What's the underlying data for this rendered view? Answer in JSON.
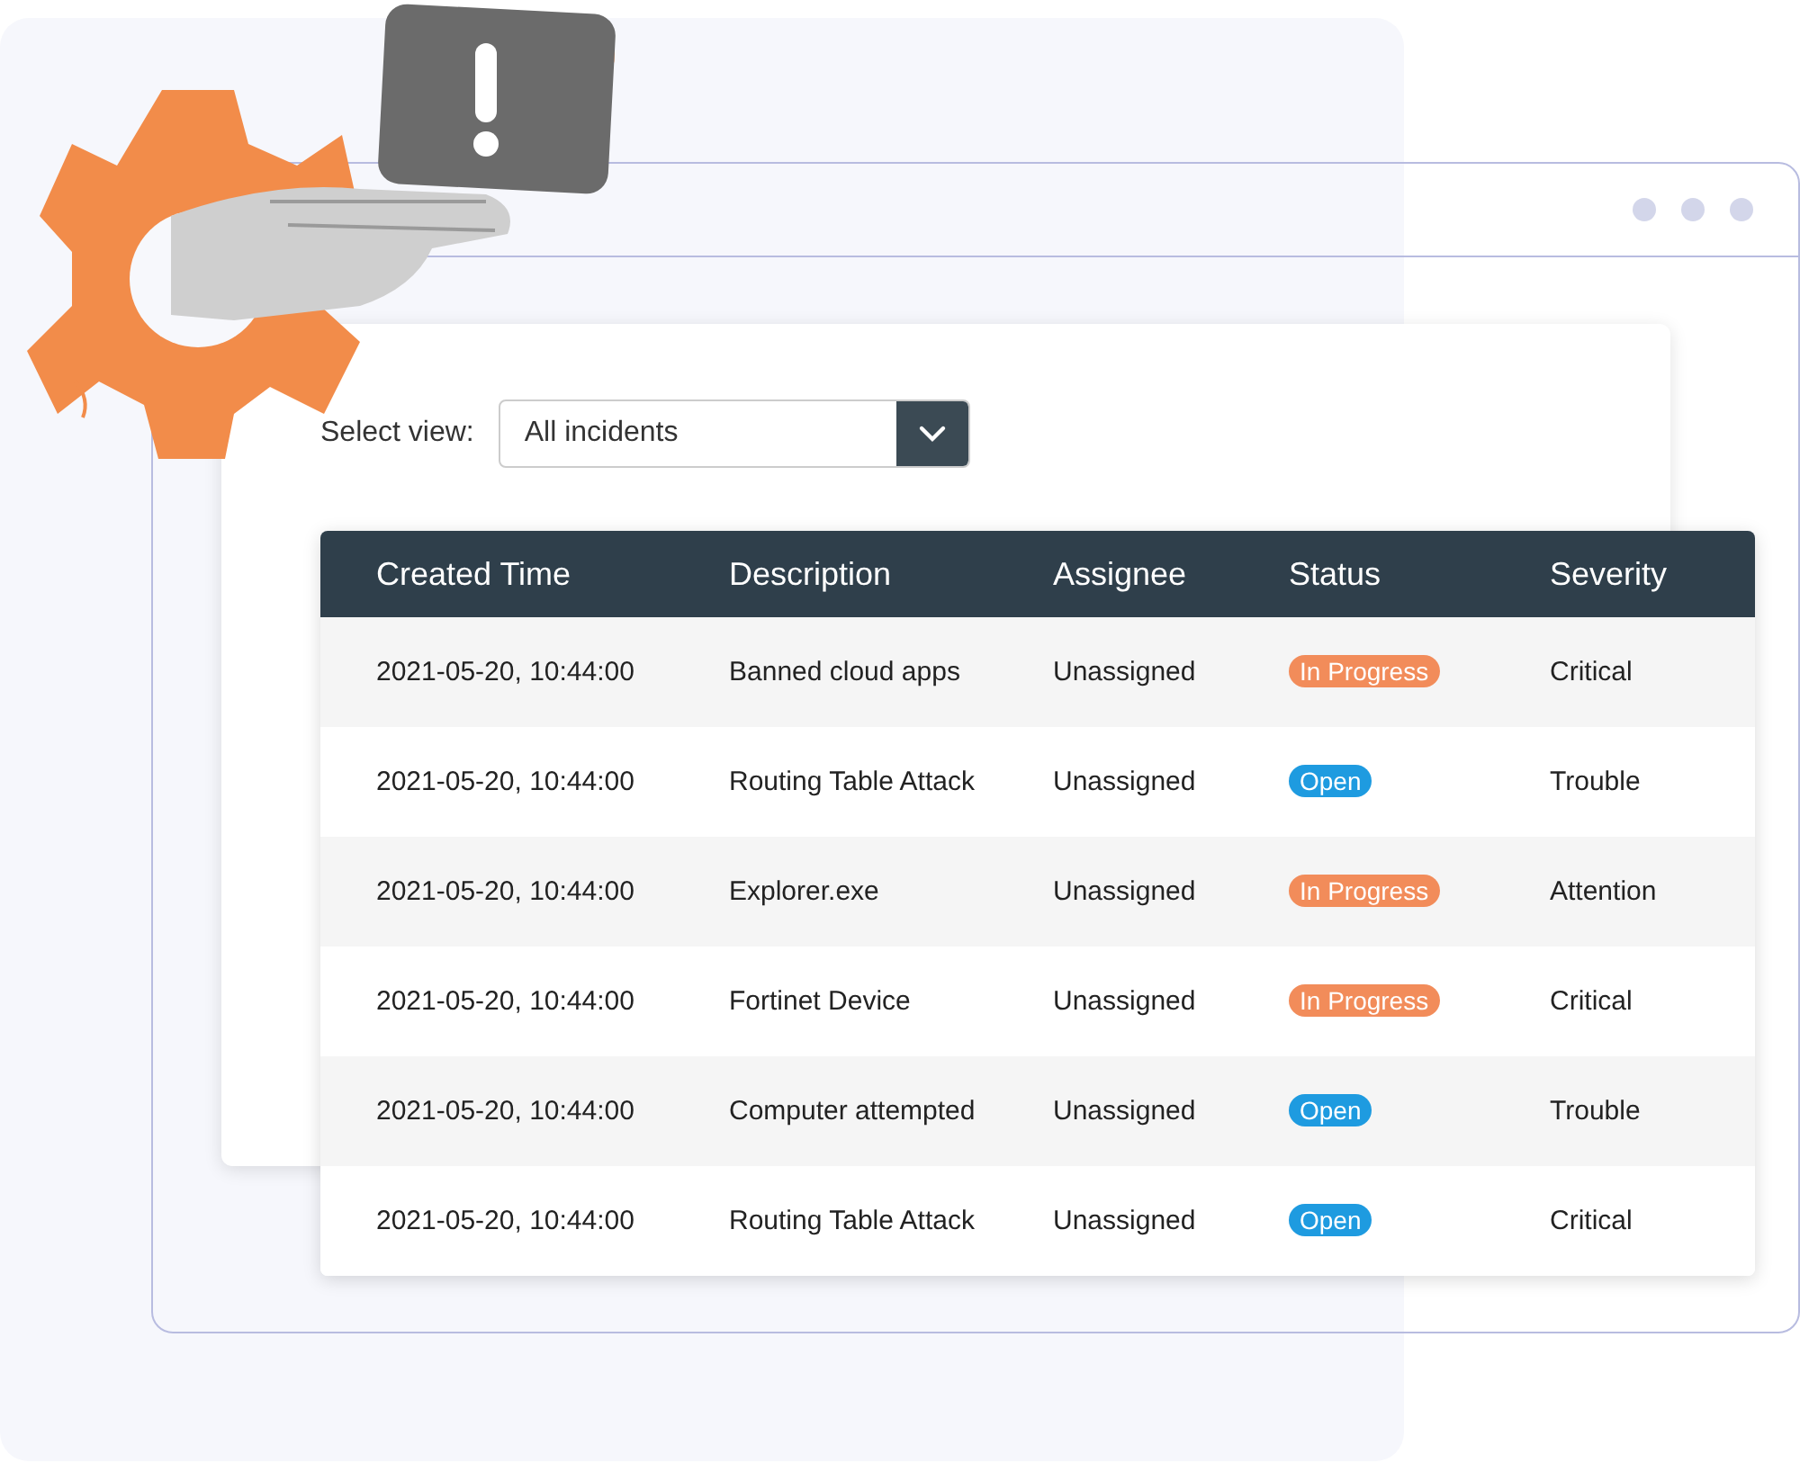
{
  "view_selector": {
    "label": "Select view:",
    "value": "All incidents"
  },
  "table": {
    "columns": [
      "Created Time",
      "Description",
      "Assignee",
      "Status",
      "Severity"
    ],
    "rows": [
      {
        "created": "2021-05-20, 10:44:00",
        "description": "Banned cloud apps",
        "assignee": "Unassigned",
        "status": {
          "label": "In Progress",
          "color": "#f28c5a"
        },
        "severity": "Critical"
      },
      {
        "created": "2021-05-20, 10:44:00",
        "description": "Routing Table Attack",
        "assignee": "Unassigned",
        "status": {
          "label": "Open",
          "color": "#1e9be0"
        },
        "severity": "Trouble"
      },
      {
        "created": "2021-05-20, 10:44:00",
        "description": "Explorer.exe",
        "assignee": "Unassigned",
        "status": {
          "label": "In Progress",
          "color": "#f28c5a"
        },
        "severity": "Attention"
      },
      {
        "created": "2021-05-20, 10:44:00",
        "description": "Fortinet Device",
        "assignee": "Unassigned",
        "status": {
          "label": "In Progress",
          "color": "#f28c5a"
        },
        "severity": "Critical"
      },
      {
        "created": "2021-05-20, 10:44:00",
        "description": "Computer attempted",
        "assignee": "Unassigned",
        "status": {
          "label": "Open",
          "color": "#1e9be0"
        },
        "severity": "Trouble"
      },
      {
        "created": "2021-05-20, 10:44:00",
        "description": "Routing Table Attack",
        "assignee": "Unassigned",
        "status": {
          "label": "Open",
          "color": "#1e9be0"
        },
        "severity": "Critical"
      }
    ]
  }
}
